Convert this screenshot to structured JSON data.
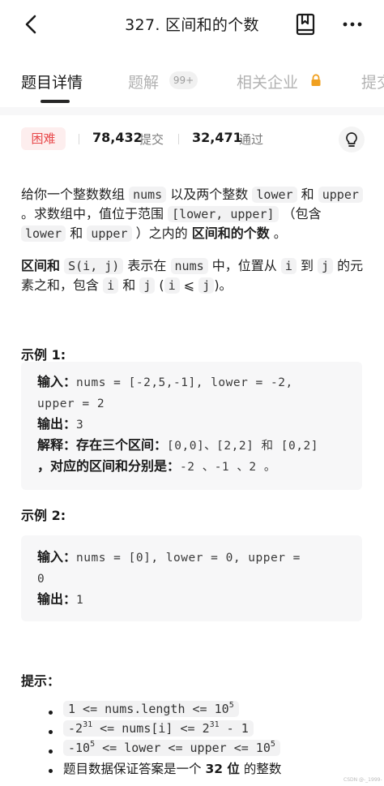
{
  "header": {
    "title": "327. 区间和的个数"
  },
  "tabs": [
    {
      "label": "题目详情"
    },
    {
      "label": "题解",
      "badge": "99+"
    },
    {
      "label": "相关企业"
    },
    {
      "label": "提交"
    }
  ],
  "stats": {
    "difficulty": "困难",
    "submissions": "78,432",
    "submissions_label": "提交",
    "accepted": "32,471",
    "accepted_label": "通过"
  },
  "description": {
    "p1": {
      "t1": "给你一个整数数组 ",
      "c1": "nums",
      "t2": " 以及两个整数 ",
      "c2": "lower",
      "t3": " 和 ",
      "c3": "upper",
      "t4": " 。求数组中，值位于范围 ",
      "c4": "[lower, upper]",
      "t5": " （包含 ",
      "c5": "lower",
      "t6": " 和 ",
      "c6": "upper",
      "t7": " ）之内的 ",
      "b1": "区间和的个数",
      "t8": " 。"
    },
    "p2": {
      "b1": "区间和",
      "c1": "S(i, j)",
      "t1": " 表示在 ",
      "c2": "nums",
      "t2": " 中，位置从 ",
      "c3": "i",
      "t3": " 到 ",
      "c4": "j",
      "t4": " 的元素之和，包含 ",
      "c5": "i",
      "t5": " 和 ",
      "c6": "j",
      "t6": " (",
      "c7": "i",
      "t7": " ⩽ ",
      "c8": "j",
      "t8": ")。"
    }
  },
  "examples": [
    {
      "title": "示例 1:",
      "input_label": "输入：",
      "input_line1": "nums = [-2,5,-1], lower = -2,",
      "input_line2": "upper = 2",
      "output_label": "输出：",
      "output": "3",
      "explain_label": "解释：",
      "explain_line1_text": "存在三个区间：",
      "explain_line1_code": "[0,0]、[2,2] 和 [0,2]",
      "explain_line2_text": "，对应的区间和分别是：",
      "explain_line2_code": "-2 、-1 、2 。"
    },
    {
      "title": "示例 2:",
      "input_label": "输入：",
      "input_line1": "nums = [0], lower = 0, upper =",
      "input_line2": "0",
      "output_label": "输出：",
      "output": "1"
    }
  ],
  "hints": {
    "title": "提示：",
    "h1": {
      "a": "1 <= nums.length <= 10",
      "sup": "5"
    },
    "h2": {
      "a": "-2",
      "sup1": "31",
      "b": " <= nums[i] <= 2",
      "sup2": "31",
      "c": " - 1"
    },
    "h3": {
      "a": "-10",
      "sup1": "5",
      "b": " <= lower <= upper <= 10",
      "sup2": "5"
    },
    "h4": {
      "t1": "题目数据保证答案是一个 ",
      "b": "32 位",
      "t2": " 的整数"
    }
  },
  "watermark": "CSDN @-_1999-"
}
